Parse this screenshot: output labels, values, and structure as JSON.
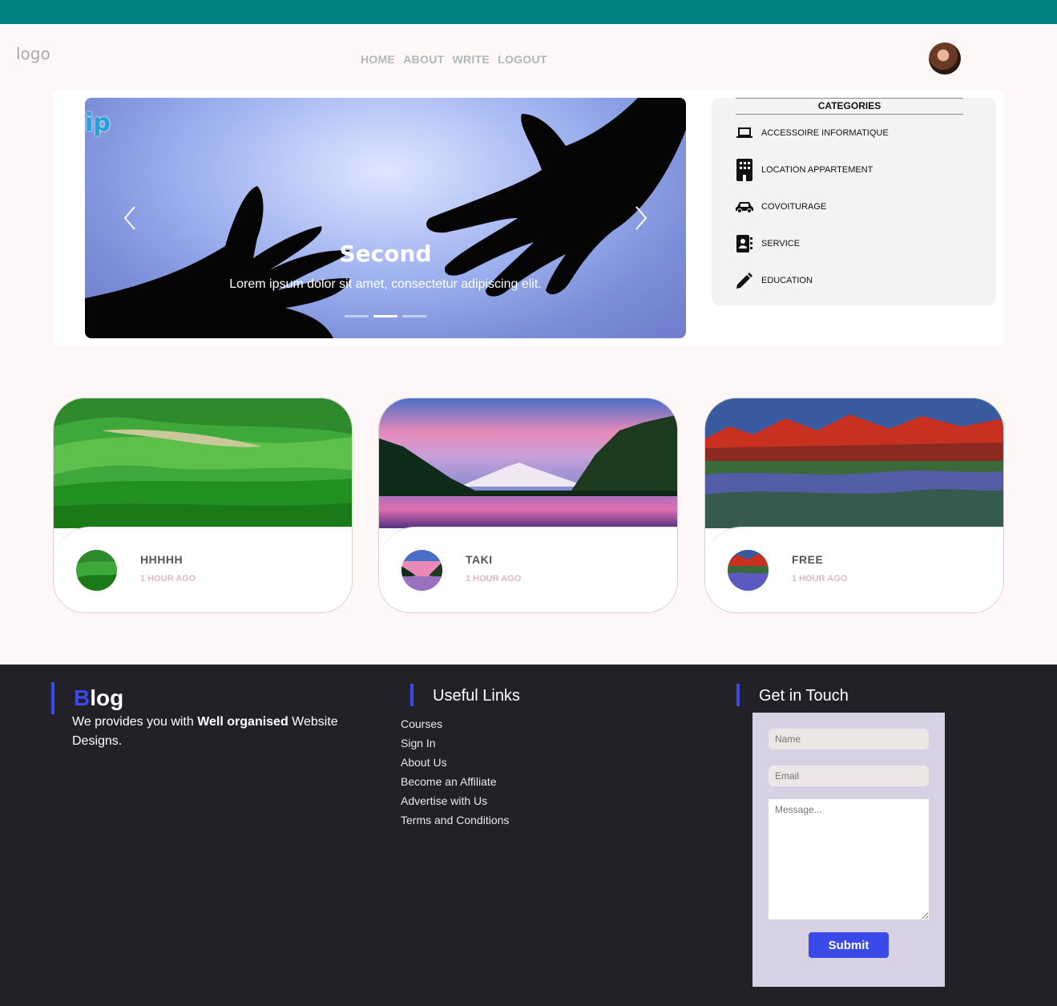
{
  "colors": {
    "topbar": "#008080",
    "accent": "#3a4ae8",
    "footer_bg": "#222128",
    "form_bg": "#d6d2e4"
  },
  "header": {
    "logo": "logo",
    "nav": [
      "HOME",
      "ABOUT",
      "WRITE",
      "LOGOUT"
    ],
    "avatar_icon": "user-avatar"
  },
  "carousel": {
    "brand": "ip",
    "title": "Second",
    "text": "Lorem ipsum dolor sit amet, consectetur adipiscing elit.",
    "slide_count": 3,
    "active_slide": 2,
    "prev_icon": "chevron-left-icon",
    "next_icon": "chevron-right-icon"
  },
  "categories": {
    "title": "CATEGORIES",
    "items": [
      {
        "label": "ACCESSOIRE INFORMATIQUE",
        "icon": "laptop-icon"
      },
      {
        "label": "LOCATION APPARTEMENT",
        "icon": "building-icon"
      },
      {
        "label": "COVOITURAGE",
        "icon": "car-icon"
      },
      {
        "label": "SERVICE",
        "icon": "contact-book-icon"
      },
      {
        "label": "EDUCATION",
        "icon": "pencil-icon"
      }
    ]
  },
  "posts": [
    {
      "title": "HHHHH",
      "time": "1 HOUR AGO",
      "image": "green-hills"
    },
    {
      "title": "TAKI",
      "time": "1 HOUR AGO",
      "image": "mountain-lake-sunset"
    },
    {
      "title": "FREE",
      "time": "1 HOUR AGO",
      "image": "red-mountains-flower-field"
    }
  ],
  "footer": {
    "blog_first": "B",
    "blog_rest": "log",
    "blog_text_1": "We provides you with ",
    "blog_text_bold": "Well organised",
    "blog_text_2": " Website Designs.",
    "links_title": "Useful Links",
    "links": [
      "Courses",
      "Sign In",
      "About Us",
      "Become an Affiliate",
      "Advertise with Us",
      "Terms and Conditions"
    ],
    "touch_title": "Get in Touch",
    "form": {
      "name_placeholder": "Name",
      "email_placeholder": "Email",
      "message_placeholder": "Message...",
      "submit": "Submit"
    }
  }
}
